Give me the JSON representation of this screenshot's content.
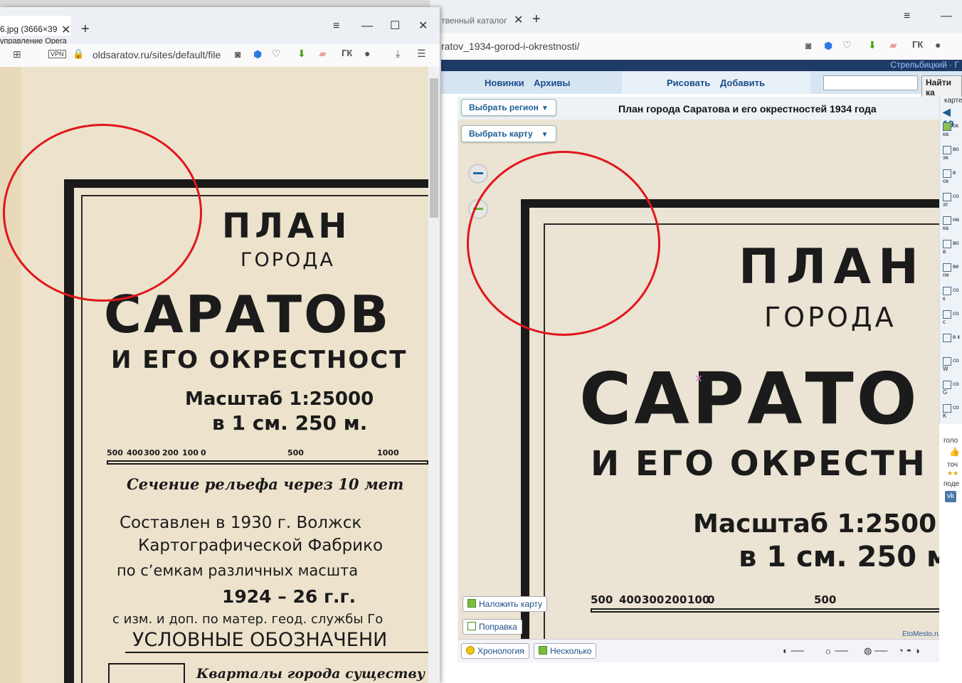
{
  "left_window": {
    "tab_title": "6.jpg (3666×39",
    "tab_hint": "управление Opera",
    "url": "oldsaratov.ru/sites/default/file",
    "vpn_label": "VPN",
    "gk_label": "ГК",
    "map_text": {
      "line1": "ПЛАН",
      "line2": "ГОРОДА",
      "line3": "САРАТОВ",
      "line4": "И ЕГО ОКРЕСТНОСТ",
      "scale1": "Масштаб   1:25000",
      "scale2": "в 1 см. 250 м.",
      "scale_ticks": [
        "500",
        "400",
        "300",
        "200",
        "100",
        "0",
        "500",
        "1000"
      ],
      "relief": "Сечение   рельефа   через  10   мет",
      "comp1": "Составлен  в 1930 г.   Волжск",
      "comp2": "Картографической   Фабрико",
      "comp3": "по сʼемкам   различных   масшта",
      "comp4": "1924 – 26 г.г.",
      "comp5": "с изм. и доп. по матер. геод. службы Го",
      "legend_title": "УСЛОВНЫЕ   ОБОЗНАЧЕНИ",
      "legend1": "Кварталы  города   существу"
    }
  },
  "right_window": {
    "tab_title": "твенный каталог",
    "url": "ratov_1934-gorod-i-okrestnosti/",
    "gk_label": "ГК",
    "site_header_right": "Стрельбицкий · Г",
    "nav": {
      "item1": "Новинки",
      "item2": "Архивы",
      "item3": "Рисовать",
      "item4": "Добавить",
      "search_button": "Найти ка"
    },
    "select_region": "Выбрать регион",
    "select_map": "Выбрать карту",
    "map_title": "План города Саратова и его окрестностей 1934 года",
    "buttons": {
      "overlay": "Наложить карту",
      "correction": "Поправка",
      "chronology": "Хронология",
      "several": "Несколько"
    },
    "watermark": "EtoMesto.ru",
    "map_text": {
      "line1": "ПЛАН",
      "line2": "ГОРОДА",
      "line3": "САРАТО",
      "line4": "И ЕГО  ОКРЕСТН",
      "scale1": "Масштаб   1:2500",
      "scale2": "в 1 см. 250 м",
      "scale_ticks": [
        "500",
        "400",
        "300",
        "200",
        "100",
        "0",
        "500"
      ]
    },
    "side_panel": {
      "top_label": "карте",
      "top_number": "19",
      "items": [
        "ок ка",
        "во эк",
        "в ок",
        "со эт",
        "на ка",
        "во в",
        "ве пе",
        "со к",
        "со с",
        "в к",
        "со W",
        "со G",
        "со K"
      ],
      "bottom": [
        "голо",
        "точ",
        "поде"
      ]
    }
  },
  "colors": {
    "accent_blue": "#1b5f96",
    "circle_red": "#e1161c",
    "map_paper": "#ede4d0"
  }
}
